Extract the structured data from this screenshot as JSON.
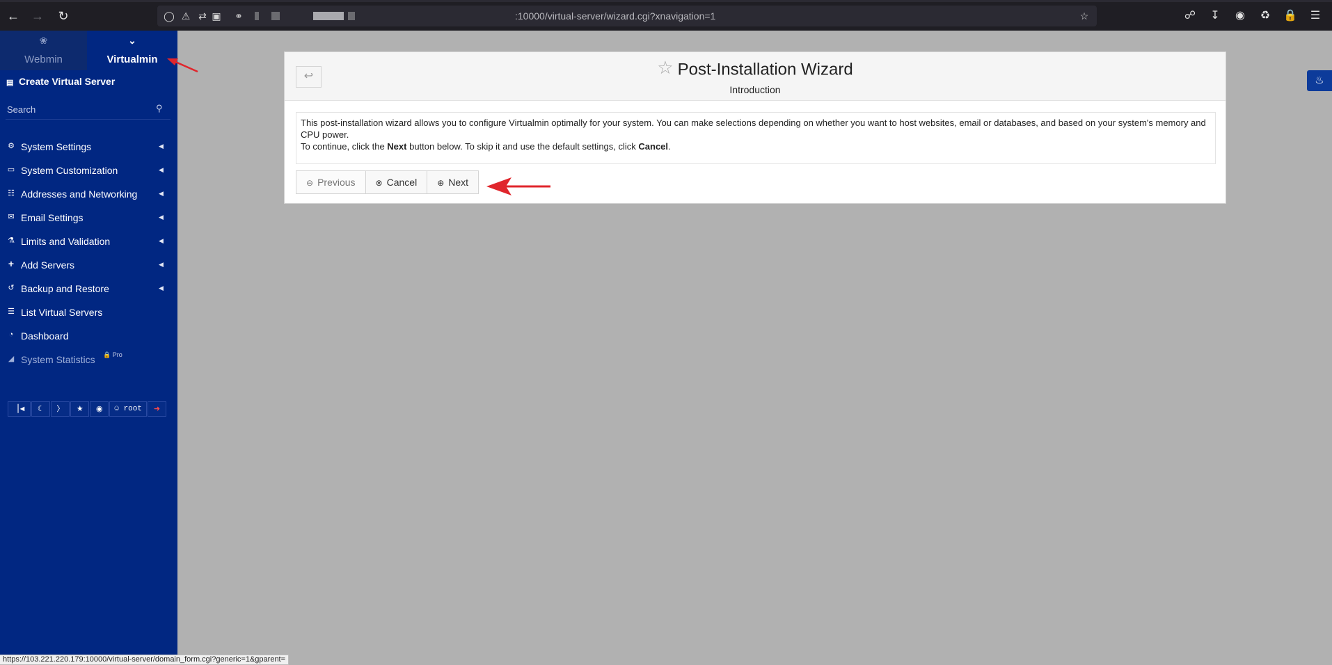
{
  "browser": {
    "url": ":10000/virtual-server/wizard.cgi?xnavigation=1",
    "icons": [
      "back-icon",
      "forward-icon",
      "reload-icon",
      "shield-icon",
      "lock-warning-icon",
      "permissions-icon",
      "screen-share-blocked-icon",
      "key-icon",
      "bookmark-star-icon",
      "pocket-icon",
      "download-icon",
      "account-icon",
      "extensions-icon",
      "lock-icon",
      "menu-icon"
    ]
  },
  "sidebar": {
    "tabs": [
      {
        "label": "Webmin",
        "active": false
      },
      {
        "label": "Virtualmin",
        "active": true
      }
    ],
    "create_label": "Create Virtual Server",
    "search_placeholder": "Search",
    "items": [
      {
        "label": "System Settings",
        "icon": "gear-icon",
        "caret": true
      },
      {
        "label": "System Customization",
        "icon": "laptop-icon",
        "caret": true
      },
      {
        "label": "Addresses and Networking",
        "icon": "network-icon",
        "caret": true
      },
      {
        "label": "Email Settings",
        "icon": "envelope-icon",
        "caret": true
      },
      {
        "label": "Limits and Validation",
        "icon": "flask-icon",
        "caret": true
      },
      {
        "label": "Add Servers",
        "icon": "plus-icon",
        "caret": true
      },
      {
        "label": "Backup and Restore",
        "icon": "history-icon",
        "caret": true
      },
      {
        "label": "List Virtual Servers",
        "icon": "list-icon",
        "caret": false
      },
      {
        "label": "Dashboard",
        "icon": "gauge-icon",
        "caret": false
      },
      {
        "label": "System Statistics",
        "icon": "chart-icon",
        "caret": false,
        "badge": "Pro"
      }
    ],
    "footer": {
      "user": "root"
    }
  },
  "panel": {
    "title": "Post-Installation Wizard",
    "subtitle": "Introduction",
    "intro_line1": "This post-installation wizard allows you to configure Virtualmin optimally for your system. You can make selections depending on whether you want to host websites, email or databases, and based on your system's memory and CPU power.",
    "intro_line2_a": "To continue, click the ",
    "intro_line2_next": "Next",
    "intro_line2_b": " button below. To skip it and use the default settings, click ",
    "intro_line2_cancel": "Cancel",
    "intro_line2_c": ".",
    "buttons": {
      "previous": "Previous",
      "cancel": "Cancel",
      "next": "Next"
    }
  },
  "statusbar": {
    "text": "https://103.221.220.179:10000/virtual-server/domain_form.cgi?generic=1&gparent="
  },
  "colors": {
    "sidebar_bg": "#012782",
    "page_bg": "#b1b1b1",
    "annotation_red": "#e0262c"
  }
}
